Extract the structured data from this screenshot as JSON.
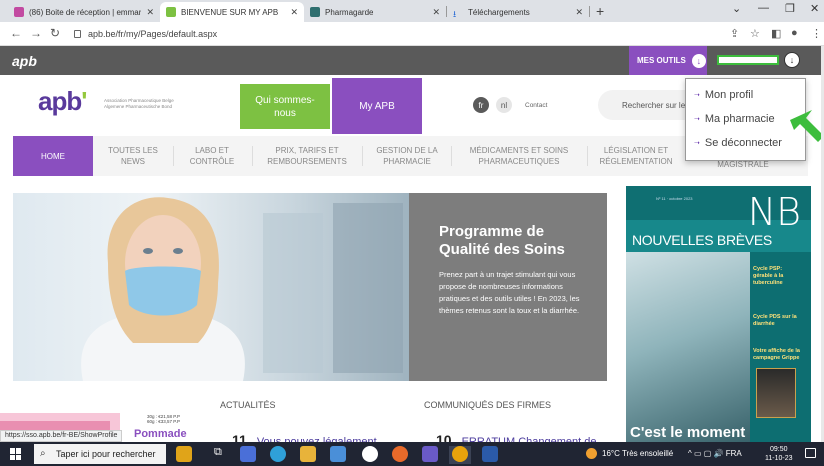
{
  "browser": {
    "tabs": [
      {
        "label": "(86) Boite de réception | emmar",
        "color": "#c24aa1"
      },
      {
        "label": "BIENVENUE SUR MY APB",
        "color": "#7dc142"
      },
      {
        "label": "Pharmagarde",
        "color": "#2f6f6f"
      },
      {
        "label": "Téléchargements",
        "color": "#2f6fd6"
      }
    ],
    "url": "apb.be/fr/my/Pages/default.aspx",
    "status_url": "https://sso.apb.be/fr-BE/ShowProfile"
  },
  "topbar": {
    "logo": "apb",
    "tools_label": "MES OUTILS"
  },
  "header": {
    "logo": "apb",
    "assoc_line1": "Association Pharmaceutique Belge",
    "assoc_line2": "Algemene Pharmaceutische Bond",
    "qui_label": "Qui sommes-nous",
    "myapb_label": "My APB",
    "lang_fr": "fr",
    "lang_nl": "nl",
    "contact": "Contact",
    "search_placeholder": "Rechercher sur le site"
  },
  "dropdown": {
    "items": [
      "Mon profil",
      "Ma pharmacie",
      "Se déconnecter"
    ]
  },
  "nav": {
    "items": [
      {
        "label": "HOME"
      },
      {
        "label": "TOUTES LES NEWS"
      },
      {
        "label": "LABO ET CONTRÔLE"
      },
      {
        "label": "PRIX, TARIFS ET REMBOURSEMENTS"
      },
      {
        "label": "GESTION DE LA PHARMACIE"
      },
      {
        "label": "MÉDICAMENTS ET SOINS PHARMACEUTIQUES"
      },
      {
        "label": "LÉGISLATION ET RÉGLEMENTATION"
      },
      {
        "label": "MAGISTRALE"
      }
    ]
  },
  "hero": {
    "title": "Programme de Qualité des Soins",
    "text": "Prenez part à un trajet stimulant qui vous propose de nombreuses informations pratiques et des outils utiles ! En 2023, les thèmes retenus sont la toux et la diarrhée."
  },
  "magazine": {
    "nb": "NB",
    "title": "NOUVELLES BRÈVES",
    "meta": "Nº 11 · octobre 2023",
    "label1": "Cycle PSP: gérable à la tuberculine",
    "label2": "Cycle PDS sur la diarrhée",
    "label3": "Votre affiche de la campagne Grippe",
    "moment": "C'est le moment"
  },
  "lower": {
    "actualites": "ACTUALITÉS",
    "communiques": "COMMUNIQUÉS DES FIRMES",
    "teaser1_num": "11",
    "teaser1": "Vous pouvez légalement",
    "teaser2_num": "10",
    "teaser2": "ERRATUM Changement de",
    "pommade": "Pommade",
    "price1": "30g : €21,58 P.P",
    "price2": "60g : €33,57 P.P"
  },
  "taskbar": {
    "search": "Taper ici pour rechercher",
    "weather": "16°C  Très ensoleillé",
    "lang": "FRA",
    "time": "09:50",
    "date": "11-10-23"
  }
}
